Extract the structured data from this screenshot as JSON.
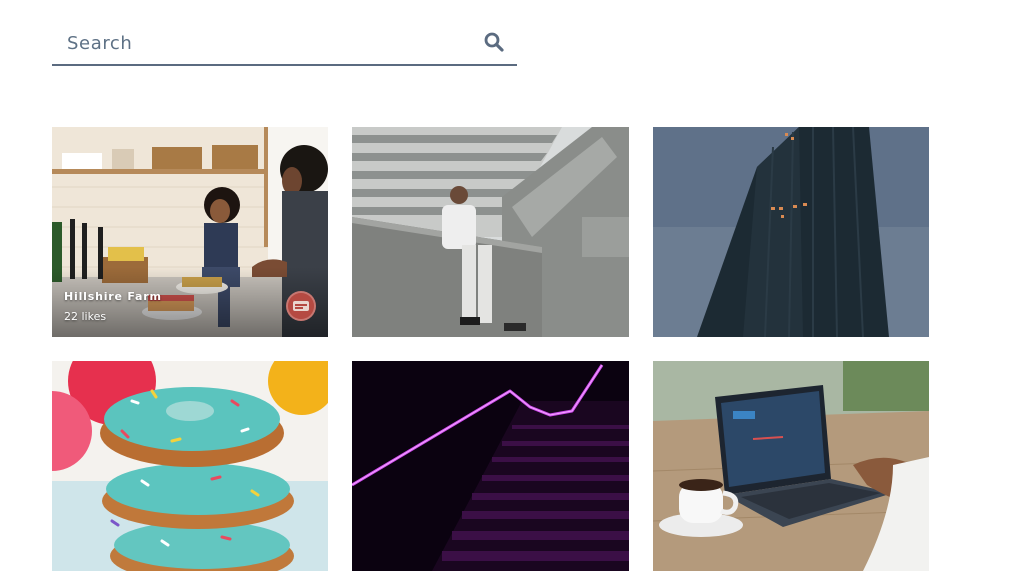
{
  "search": {
    "placeholder": "Search",
    "value": "",
    "icon": "search-icon"
  },
  "gallery": {
    "cards": [
      {
        "title": "Hillshire Farm",
        "likes": "22 likes",
        "avatar": "brand-logo",
        "show_info": true
      },
      {
        "title": "",
        "likes": "",
        "show_info": false
      },
      {
        "title": "",
        "likes": "",
        "show_info": false
      },
      {
        "title": "",
        "likes": "",
        "show_info": false
      },
      {
        "title": "",
        "likes": "",
        "show_info": false
      },
      {
        "title": "",
        "likes": "",
        "show_info": false
      }
    ]
  },
  "colors": {
    "search_underline": "#5b6b80",
    "search_text": "#5e7185",
    "avatar_bg": "#b54a42"
  }
}
